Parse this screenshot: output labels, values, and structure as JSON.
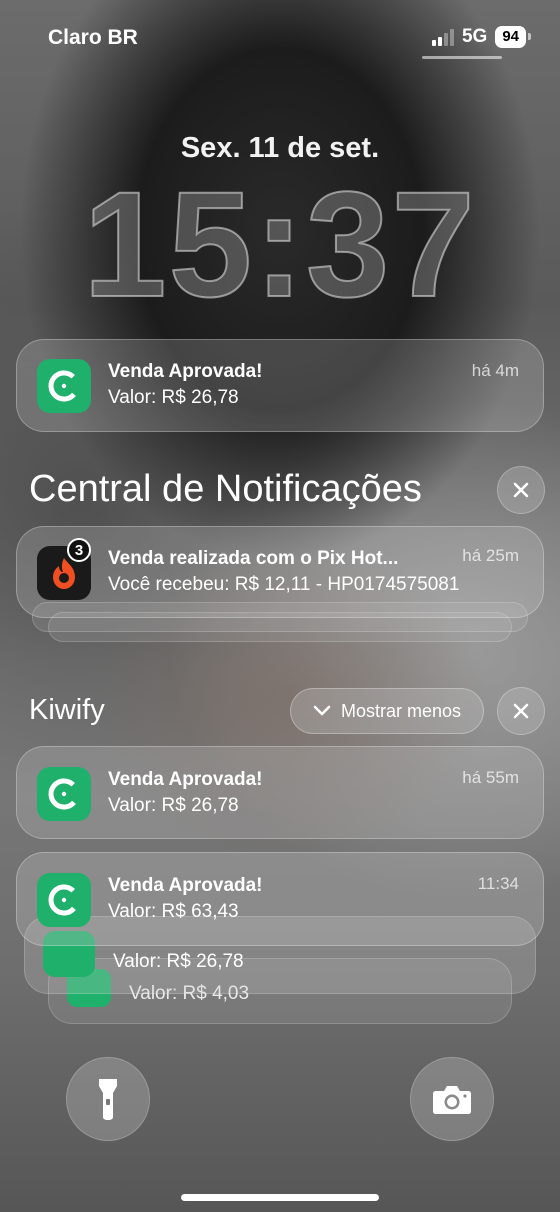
{
  "status_bar": {
    "carrier": "Claro BR",
    "network": "5G",
    "battery": "94",
    "icons": [
      "signal-icon",
      "battery-icon"
    ]
  },
  "lock_screen": {
    "date": "Sex. 11 de set.",
    "time": "15:37"
  },
  "top_notification": {
    "app_icon": "kiwify-icon",
    "title": "Venda Aprovada!",
    "body": "Valor: R$ 26,78",
    "time": "há 4m"
  },
  "notification_center": {
    "title": "Central de Notificações",
    "close_icon": "close-icon",
    "hotmart": {
      "app_icon": "hotmart-icon",
      "badge": "3",
      "title": "Venda realizada com o Pix Hot...",
      "body": "Você recebeu: R$ 12,11 - HP0174575081",
      "time": "há 25m"
    }
  },
  "kiwify_group": {
    "title": "Kiwify",
    "show_less": "Mostrar menos",
    "notifications": [
      {
        "title": "Venda Aprovada!",
        "body": "Valor: R$ 26,78",
        "time": "há 55m"
      },
      {
        "title": "Venda Aprovada!",
        "body": "Valor: R$ 63,43",
        "time": "11:34"
      },
      {
        "title": "",
        "body": "Valor: R$ 26,78",
        "time": ""
      },
      {
        "title": "",
        "body": "Valor: R$ 4,03",
        "time": ""
      }
    ]
  },
  "quick_actions": {
    "flashlight": "flashlight-icon",
    "camera": "camera-icon"
  },
  "colors": {
    "kiwify_green": "#1fb06b",
    "hotmart_orange": "#f04e23"
  }
}
